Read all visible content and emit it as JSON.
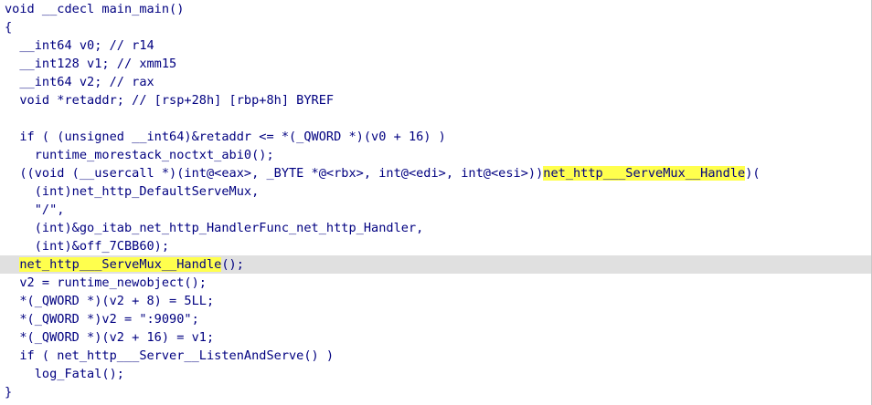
{
  "lines": [
    [
      "void __cdecl main_main()"
    ],
    [
      "{"
    ],
    [
      "  __int64 v0; // r14"
    ],
    [
      "  __int128 v1; // xmm15"
    ],
    [
      "  __int64 v2; // rax"
    ],
    [
      "  void *retaddr; // [rsp+28h] [rbp+8h] BYREF"
    ],
    [
      ""
    ],
    [
      "  if ( (unsigned __int64)&retaddr <= *(_QWORD *)(v0 + 16) )"
    ],
    [
      "    runtime_morestack_noctxt_abi0();"
    ],
    [
      "  ((void (__usercall *)(int@<eax>, _BYTE *@<rbx>, int@<edi>, int@<esi>))",
      "net_http___ServeMux__Handle",
      ")("
    ],
    [
      "    (int)net_http_DefaultServeMux,"
    ],
    [
      "    \"/\","
    ],
    [
      "    (int)&go_itab_net_http_HandlerFunc_net_http_Handler,"
    ],
    [
      "    (int)&off_7CBB60);"
    ],
    [
      "  ",
      "net_http___ServeMux__Handle",
      "();"
    ],
    [
      "  v2 = runtime_newobject();"
    ],
    [
      "  *(_QWORD *)(v2 + 8) = 5LL;"
    ],
    [
      "  *(_QWORD *)v2 = \":9090\";"
    ],
    [
      "  *(_QWORD *)(v2 + 16) = v1;"
    ],
    [
      "  if ( net_http___Server__ListenAndServe() )"
    ],
    [
      "    log_Fatal();"
    ],
    [
      "}"
    ]
  ]
}
